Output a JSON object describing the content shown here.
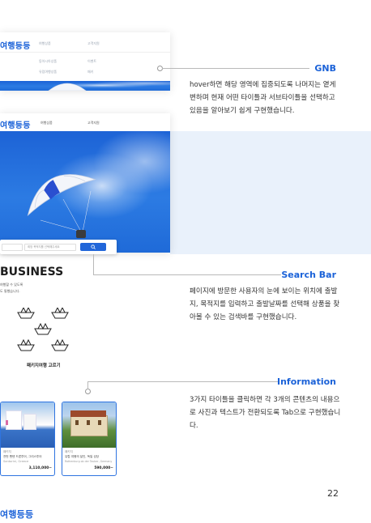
{
  "brand": "여행등등",
  "colors": {
    "accent": "#1b62d8",
    "band": "#e9f1fb"
  },
  "mock_top": {
    "nav": [
      "여행상품",
      "고객지원"
    ],
    "submenu": [
      "동아시아상품",
      "이벤트",
      "유럽여행상품",
      "패키"
    ]
  },
  "mock_main": {
    "nav": [
      "여행상품",
      "고객지원"
    ],
    "search_placeholder": "희망 목적지를 선택해주세요",
    "search_icon": "search-icon",
    "business_title": "BUSINESS",
    "business_lines": [
      "여행할 수 있도록",
      "도 통했습니다."
    ],
    "package_caption": "패키지여행 고르기",
    "boat_icon": "paper-boat-icon"
  },
  "products": [
    {
      "tag": "패키지",
      "name": "전번 팬텐 드론투어, 그리스투어",
      "sub": "Santorini, Greece",
      "price": "3,110,000~"
    },
    {
      "tag": "패키지",
      "name": "유럽 여행의 달인, 독일 성당",
      "sub": "Rothenburg ob der Tauber, Germany",
      "price": "590,000~"
    }
  ],
  "annotations": [
    {
      "title": "GNB",
      "text": "hover하면 해당 영역에 집중되도록 나머지는 옅게 변하며 현재 어떤 타이틀과 서브타이틀을 선택하고 있음을 알아보기 쉽게 구현했습니다."
    },
    {
      "title": "Search Bar",
      "text": "페이지에 방문한 사용자의 눈에 보이는 위치에 출발지, 목적지를 입력하고 출발날짜를 선택해 상품을 찾아볼 수 있는 검색바를 구현했습니다."
    },
    {
      "title": "Information",
      "text": "3가지 타이틀을 클릭하면 각 3개의 콘텐츠의 내용으로 사진과 텍스트가 전환되도록 Tab으로 구현했습니다."
    }
  ],
  "page_number": "22",
  "footer_brand": "여행등등"
}
